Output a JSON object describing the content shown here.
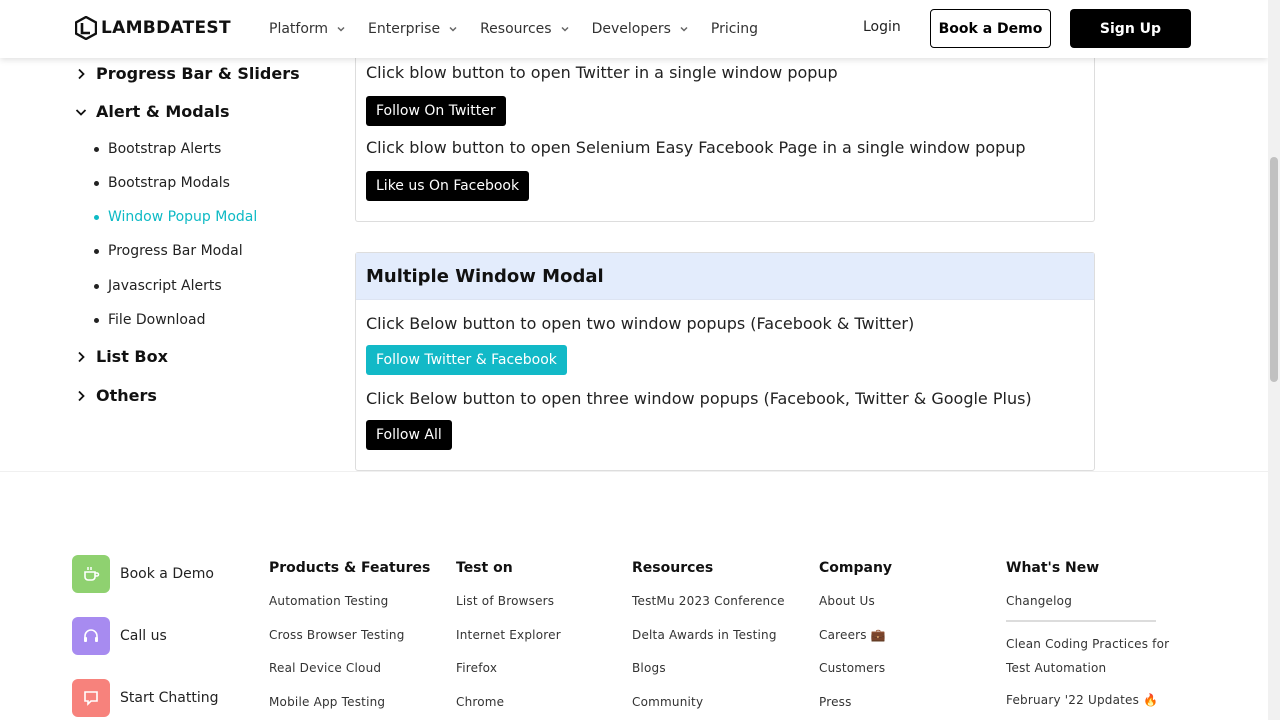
{
  "header": {
    "logo_text": "LAMBDATEST",
    "nav": [
      {
        "label": "Platform",
        "dropdown": true
      },
      {
        "label": "Enterprise",
        "dropdown": true
      },
      {
        "label": "Resources",
        "dropdown": true
      },
      {
        "label": "Developers",
        "dropdown": true
      },
      {
        "label": "Pricing",
        "dropdown": false
      }
    ],
    "login_label": "Login",
    "book_demo_label": "Book a Demo",
    "signup_label": "Sign Up"
  },
  "sidebar": {
    "sections": [
      {
        "label": "Progress Bar & Sliders",
        "expanded": false
      },
      {
        "label": "Alert & Modals",
        "expanded": true
      },
      {
        "label": "List Box",
        "expanded": false
      },
      {
        "label": "Others",
        "expanded": false
      }
    ],
    "items": [
      {
        "label": "Bootstrap Alerts",
        "active": false
      },
      {
        "label": "Bootstrap Modals",
        "active": false
      },
      {
        "label": "Window Popup Modal",
        "active": true
      },
      {
        "label": "Progress Bar Modal",
        "active": false
      },
      {
        "label": "Javascript Alerts",
        "active": false
      },
      {
        "label": "File Download",
        "active": false
      }
    ]
  },
  "single_panel": {
    "twitter_text": "Click blow button to open Twitter in a single window popup",
    "twitter_button": "Follow On Twitter",
    "facebook_text": "Click blow button to open Selenium Easy Facebook Page in a single window popup",
    "facebook_button": "Like us On Facebook"
  },
  "multiple_panel": {
    "title": "Multiple Window Modal",
    "two_text": "Click Below button to open two window popups (Facebook & Twitter)",
    "two_button": "Follow Twitter & Facebook",
    "three_text": "Click Below button to open three window popups (Facebook, Twitter & Google Plus)",
    "three_button": "Follow All"
  },
  "footer": {
    "contacts": [
      {
        "label": "Book a Demo",
        "icon": "coffee-icon",
        "color": "#8fd170"
      },
      {
        "label": "Call us",
        "icon": "headset-icon",
        "color": "#a78bf0"
      },
      {
        "label": "Start Chatting",
        "icon": "chat-icon",
        "color": "#f7827c"
      }
    ],
    "columns": [
      {
        "title": "Products & Features",
        "links": [
          "Automation Testing",
          "Cross Browser Testing",
          "Real Device Cloud",
          "Mobile App Testing"
        ]
      },
      {
        "title": "Test on",
        "links": [
          "List of Browsers",
          "Internet Explorer",
          "Firefox",
          "Chrome"
        ]
      },
      {
        "title": "Resources",
        "links": [
          "TestMu 2023 Conference",
          "Delta Awards in Testing",
          "Blogs",
          "Community"
        ]
      },
      {
        "title": "Company",
        "links": [
          "About Us",
          "Careers 💼",
          "Customers",
          "Press"
        ]
      }
    ],
    "whats_new": {
      "title": "What's New",
      "changelog": "Changelog",
      "items": [
        "Clean Coding Practices for Test Automation",
        "February '22 Updates 🔥"
      ]
    }
  },
  "colors": {
    "accent": "#0ebac5",
    "teal_button": "#12b9c7",
    "panel_header": "#e3ecfc"
  }
}
